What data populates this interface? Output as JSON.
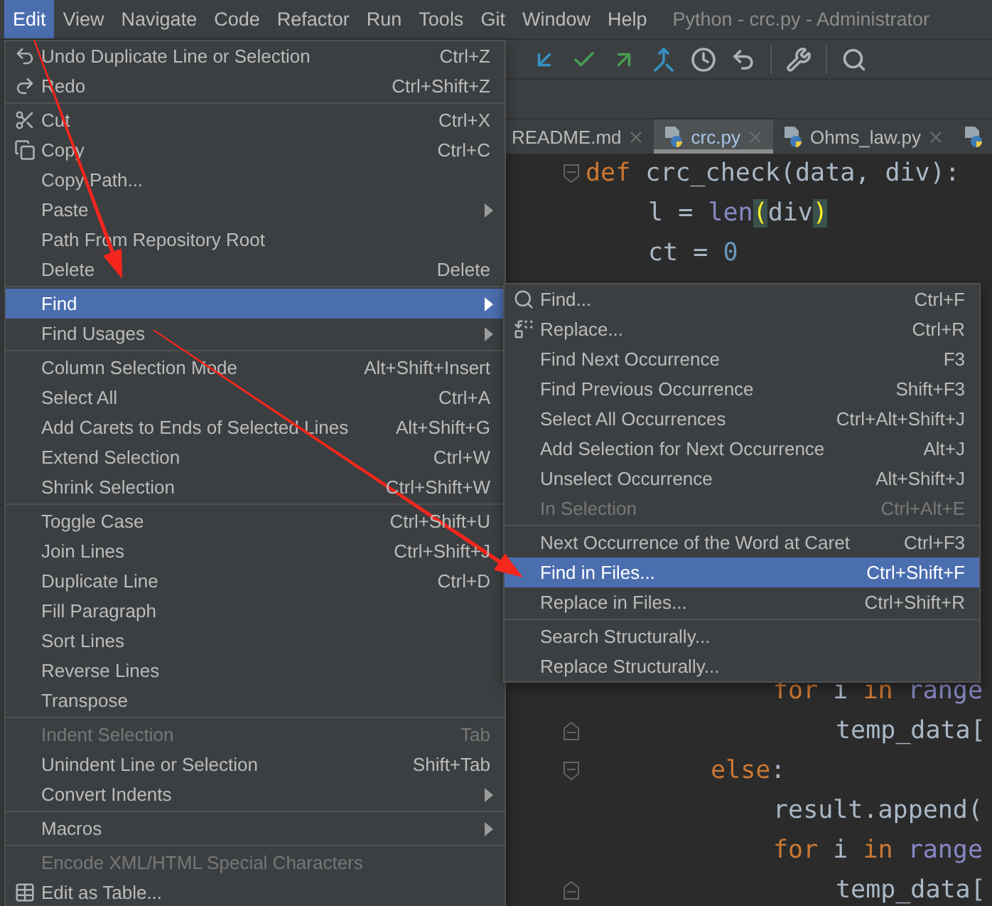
{
  "menu_bar": {
    "items": [
      {
        "label": "Edit",
        "selected": true
      },
      {
        "label": "View",
        "selected": false
      },
      {
        "label": "Navigate",
        "selected": false
      },
      {
        "label": "Code",
        "selected": false
      },
      {
        "label": "Refactor",
        "selected": false
      },
      {
        "label": "Run",
        "selected": false
      },
      {
        "label": "Tools",
        "selected": false
      },
      {
        "label": "Git",
        "selected": false
      },
      {
        "label": "Window",
        "selected": false
      },
      {
        "label": "Help",
        "selected": false
      }
    ],
    "window_title": "Python - crc.py - Administrator"
  },
  "tabs": [
    {
      "label": "README.md",
      "file_icon": false,
      "selected": false
    },
    {
      "label": "crc.py",
      "file_icon": true,
      "selected": true
    },
    {
      "label": "Ohms_law.py",
      "file_icon": true,
      "selected": false
    },
    {
      "file_icon": true,
      "selected": false
    }
  ],
  "editor": {
    "lines_top": [
      {
        "kind": "fold_start",
        "tokens": [
          {
            "text": "def",
            "kind": "kw"
          },
          {
            "text": " crc_check(data, div):",
            "kind": "plain"
          }
        ],
        "children": [
          {
            "tokens": [
              {
                "text": "l = ",
                "kind": "plain"
              },
              {
                "text": "len",
                "kind": "builtin"
              },
              {
                "text": "(",
                "kind": "brace"
              },
              {
                "text": "div",
                "kind": "plain"
              },
              {
                "text": ")",
                "kind": "brace"
              }
            ]
          },
          {
            "tokens": [
              {
                "text": "ct = ",
                "kind": "plain"
              },
              {
                "text": "0",
                "kind": "num"
              }
            ]
          }
        ]
      }
    ],
    "lines_bottom": [
      {
        "children": [
          {
            "children": [
              {
                "children": [
                  {
                    "tokens": [
                      {
                        "text": "for",
                        "kind": "kw"
                      },
                      {
                        "text": " i ",
                        "kind": "plain"
                      },
                      {
                        "text": "in ",
                        "kind": "kw"
                      },
                      {
                        "text": "range",
                        "kind": "builtin"
                      }
                    ],
                    "children": [
                      {
                        "kind": "fold_end",
                        "tokens": [
                          {
                            "text": "temp_data[",
                            "kind": "plain"
                          }
                        ]
                      }
                    ]
                  }
                ]
              },
              {
                "kind": "fold_start",
                "tokens": [
                  {
                    "text": "else",
                    "kind": "kw"
                  },
                  {
                    "text": ":",
                    "kind": "plain"
                  }
                ],
                "children": [
                  {
                    "tokens": [
                      {
                        "text": "result.append(",
                        "kind": "plain"
                      }
                    ]
                  },
                  {
                    "tokens": [
                      {
                        "text": "for",
                        "kind": "kw"
                      },
                      {
                        "text": " i ",
                        "kind": "plain"
                      },
                      {
                        "text": "in ",
                        "kind": "kw"
                      },
                      {
                        "text": "range",
                        "kind": "builtin"
                      }
                    ],
                    "children": [
                      {
                        "kind": "fold_end",
                        "tokens": [
                          {
                            "text": "temp_data[",
                            "kind": "plain"
                          }
                        ]
                      }
                    ]
                  }
                ]
              }
            ]
          }
        ]
      }
    ]
  },
  "edit_menu": {
    "items": [
      {
        "kind": "undo",
        "label": "Undo Duplicate Line or Selection",
        "shortcut": "Ctrl+Z",
        "submenu": false,
        "disabled": false,
        "selected": false
      },
      {
        "kind": "redo",
        "label": "Redo",
        "shortcut": "Ctrl+Shift+Z",
        "submenu": false,
        "disabled": false,
        "selected": false
      },
      {
        "kind": "separator"
      },
      {
        "kind": "cut",
        "label": "Cut",
        "shortcut": "Ctrl+X",
        "submenu": false,
        "disabled": false,
        "selected": false
      },
      {
        "kind": "copy",
        "label": "Copy",
        "shortcut": "Ctrl+C",
        "submenu": false,
        "disabled": false,
        "selected": false
      },
      {
        "kind": "item",
        "label": "Copy Path...",
        "submenu": false,
        "disabled": false,
        "selected": false
      },
      {
        "kind": "item",
        "label": "Paste",
        "submenu": true,
        "disabled": false,
        "selected": false
      },
      {
        "kind": "item",
        "label": "Path From Repository Root",
        "submenu": false,
        "disabled": false,
        "selected": false
      },
      {
        "kind": "item",
        "label": "Delete",
        "shortcut": "Delete",
        "submenu": false,
        "disabled": false,
        "selected": false
      },
      {
        "kind": "separator"
      },
      {
        "kind": "item",
        "label": "Find",
        "submenu": true,
        "disabled": false,
        "selected": true
      },
      {
        "kind": "item",
        "label": "Find Usages",
        "submenu": true,
        "disabled": false,
        "selected": false
      },
      {
        "kind": "separator"
      },
      {
        "kind": "item",
        "label": "Column Selection Mode",
        "shortcut": "Alt+Shift+Insert",
        "submenu": false,
        "disabled": false,
        "selected": false
      },
      {
        "kind": "item",
        "label": "Select All",
        "shortcut": "Ctrl+A",
        "submenu": false,
        "disabled": false,
        "selected": false
      },
      {
        "kind": "item",
        "label": "Add Carets to Ends of Selected Lines",
        "shortcut": "Alt+Shift+G",
        "submenu": false,
        "disabled": false,
        "selected": false
      },
      {
        "kind": "item",
        "label": "Extend Selection",
        "shortcut": "Ctrl+W",
        "submenu": false,
        "disabled": false,
        "selected": false
      },
      {
        "kind": "item",
        "label": "Shrink Selection",
        "shortcut": "Ctrl+Shift+W",
        "submenu": false,
        "disabled": false,
        "selected": false
      },
      {
        "kind": "separator"
      },
      {
        "kind": "item",
        "label": "Toggle Case",
        "shortcut": "Ctrl+Shift+U",
        "submenu": false,
        "disabled": false,
        "selected": false
      },
      {
        "kind": "item",
        "label": "Join Lines",
        "shortcut": "Ctrl+Shift+J",
        "submenu": false,
        "disabled": false,
        "selected": false
      },
      {
        "kind": "item",
        "label": "Duplicate Line",
        "shortcut": "Ctrl+D",
        "submenu": false,
        "disabled": false,
        "selected": false
      },
      {
        "kind": "item",
        "label": "Fill Paragraph",
        "submenu": false,
        "disabled": false,
        "selected": false
      },
      {
        "kind": "item",
        "label": "Sort Lines",
        "submenu": false,
        "disabled": false,
        "selected": false
      },
      {
        "kind": "item",
        "label": "Reverse Lines",
        "submenu": false,
        "disabled": false,
        "selected": false
      },
      {
        "kind": "item",
        "label": "Transpose",
        "submenu": false,
        "disabled": false,
        "selected": false
      },
      {
        "kind": "separator"
      },
      {
        "kind": "item",
        "label": "Indent Selection",
        "shortcut": "Tab",
        "submenu": false,
        "disabled": true,
        "selected": false
      },
      {
        "kind": "item",
        "label": "Unindent Line or Selection",
        "shortcut": "Shift+Tab",
        "submenu": false,
        "disabled": false,
        "selected": false
      },
      {
        "kind": "item",
        "label": "Convert Indents",
        "submenu": true,
        "disabled": false,
        "selected": false
      },
      {
        "kind": "separator"
      },
      {
        "kind": "item",
        "label": "Macros",
        "submenu": true,
        "disabled": false,
        "selected": false
      },
      {
        "kind": "separator"
      },
      {
        "kind": "item",
        "label": "Encode XML/HTML Special Characters",
        "submenu": false,
        "disabled": true,
        "selected": false
      },
      {
        "kind": "table",
        "label": "Edit as Table...",
        "submenu": false,
        "disabled": false,
        "selected": false
      }
    ]
  },
  "find_submenu": {
    "items": [
      {
        "kind": "find",
        "label": "Find...",
        "shortcut": "Ctrl+F",
        "submenu": false,
        "disabled": false,
        "selected": false
      },
      {
        "kind": "replace",
        "label": "Replace...",
        "shortcut": "Ctrl+R",
        "submenu": false,
        "disabled": false,
        "selected": false
      },
      {
        "kind": "item",
        "label": "Find Next Occurrence",
        "shortcut": "F3",
        "submenu": false,
        "disabled": false,
        "selected": false
      },
      {
        "kind": "item",
        "label": "Find Previous Occurrence",
        "shortcut": "Shift+F3",
        "submenu": false,
        "disabled": false,
        "selected": false
      },
      {
        "kind": "item",
        "label": "Select All Occurrences",
        "shortcut": "Ctrl+Alt+Shift+J",
        "submenu": false,
        "disabled": false,
        "selected": false
      },
      {
        "kind": "item",
        "label": "Add Selection for Next Occurrence",
        "shortcut": "Alt+J",
        "submenu": false,
        "disabled": false,
        "selected": false
      },
      {
        "kind": "item",
        "label": "Unselect Occurrence",
        "shortcut": "Alt+Shift+J",
        "submenu": false,
        "disabled": false,
        "selected": false
      },
      {
        "kind": "item",
        "label": "In Selection",
        "shortcut": "Ctrl+Alt+E",
        "submenu": false,
        "disabled": true,
        "selected": false
      },
      {
        "kind": "separator"
      },
      {
        "kind": "item",
        "label": "Next Occurrence of the Word at Caret",
        "shortcut": "Ctrl+F3",
        "submenu": false,
        "disabled": false,
        "selected": false
      },
      {
        "kind": "item",
        "label": "Find in Files...",
        "shortcut": "Ctrl+Shift+F",
        "submenu": false,
        "disabled": false,
        "selected": true
      },
      {
        "kind": "item",
        "label": "Replace in Files...",
        "shortcut": "Ctrl+Shift+R",
        "submenu": false,
        "disabled": false,
        "selected": false
      },
      {
        "kind": "separator"
      },
      {
        "kind": "item",
        "label": "Search Structurally...",
        "submenu": false,
        "disabled": false,
        "selected": false
      },
      {
        "kind": "item",
        "label": "Replace Structurally...",
        "submenu": false,
        "disabled": false,
        "selected": false
      }
    ]
  },
  "annotations": [
    {
      "kind": "arrow"
    },
    {
      "kind": "arrow"
    }
  ]
}
